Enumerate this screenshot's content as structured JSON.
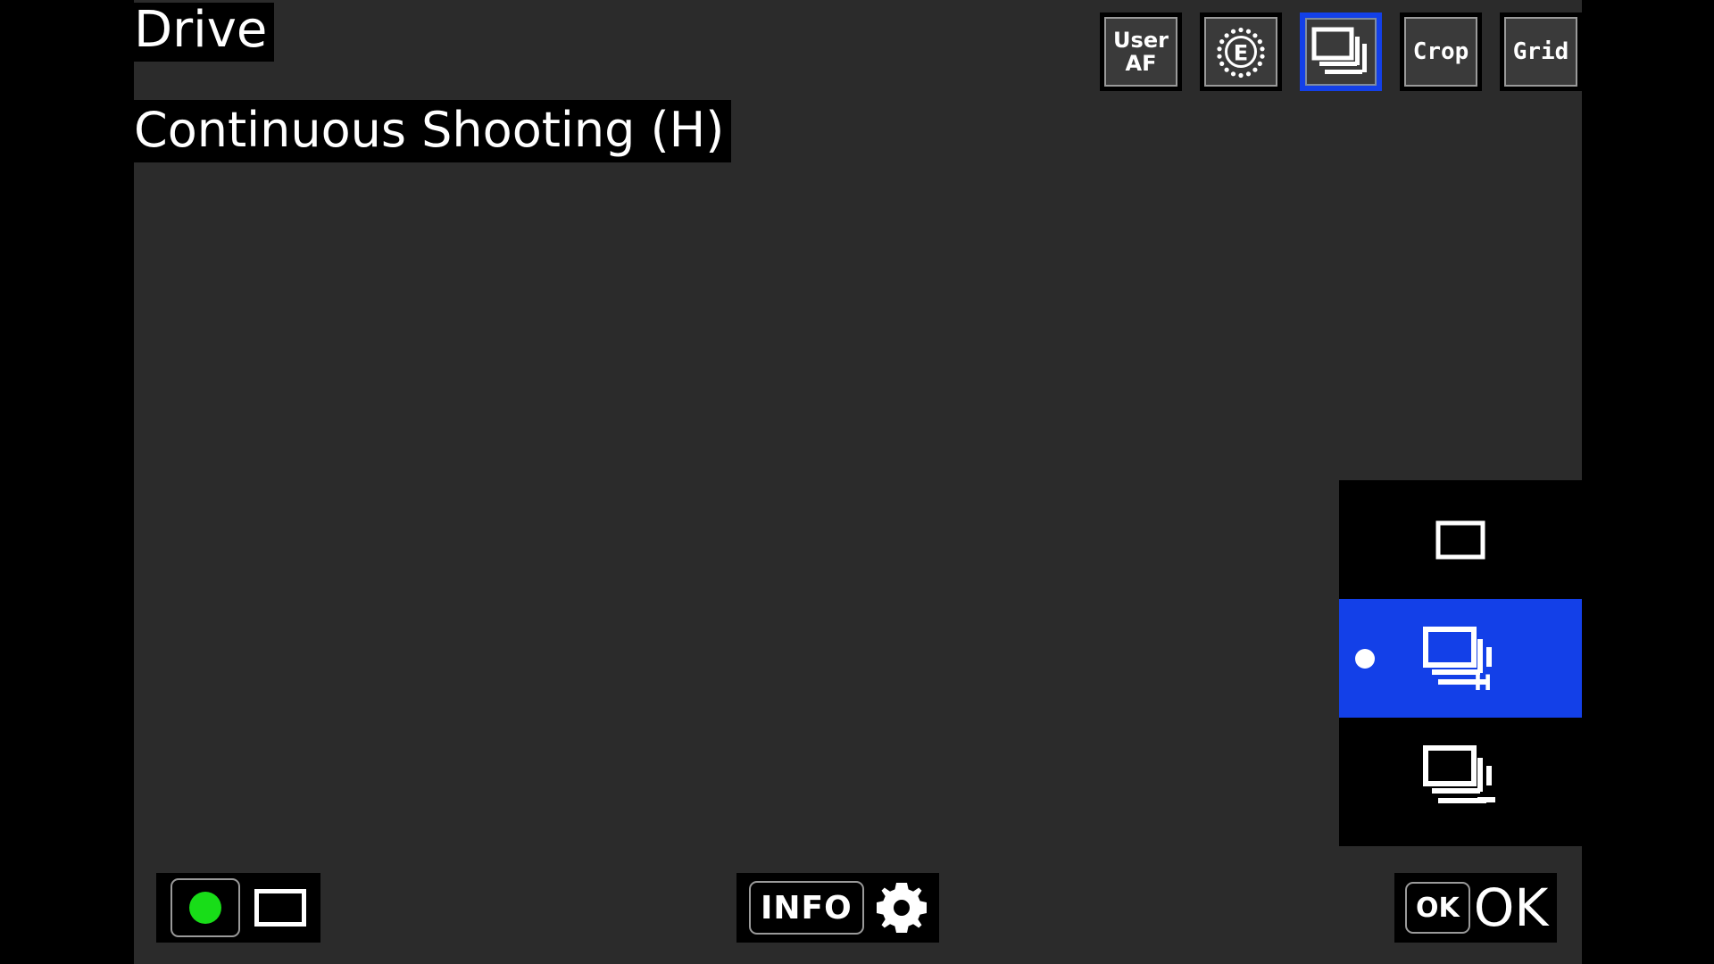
{
  "screen": {
    "name": "drive-mode-screen",
    "background_color": "#000000",
    "liveview_color": "#2b2b2b",
    "accent_color": "#1340e8",
    "record_dot_color": "#18dd18"
  },
  "header": {
    "title": "Drive",
    "value": "Continuous Shooting (H)"
  },
  "toolbar": {
    "items": [
      {
        "id": "user-af",
        "icon": "user-af-icon",
        "label_line1": "User",
        "label_line2": "AF",
        "type": "two-line-text",
        "selected": false
      },
      {
        "id": "metering",
        "icon": "metering-dial-icon",
        "label": "E",
        "type": "dial",
        "selected": false
      },
      {
        "id": "drive",
        "icon": "drive-burst-icon",
        "label": "",
        "type": "glyph",
        "selected": true
      },
      {
        "id": "crop",
        "icon": "crop-icon",
        "label": "Crop",
        "type": "word",
        "selected": false
      },
      {
        "id": "grid",
        "icon": "grid-icon",
        "label": "Grid",
        "type": "word",
        "selected": false
      }
    ]
  },
  "dropdown": {
    "name": "drive-mode-list",
    "items": [
      {
        "id": "single-frame",
        "icon": "single-frame-icon",
        "badge": "",
        "selected": false
      },
      {
        "id": "continuous-high",
        "icon": "continuous-high-icon",
        "badge": "H",
        "selected": true
      },
      {
        "id": "continuous-low",
        "icon": "continuous-low-icon",
        "badge": "L",
        "selected": false
      }
    ]
  },
  "bottom_bar": {
    "left": {
      "record_button_label": "",
      "record_icon": "record-dot-icon",
      "frame_icon": "frame-box-icon"
    },
    "center": {
      "info_label": "INFO",
      "gear_icon": "gear-icon"
    },
    "right": {
      "ok_button_label": "OK",
      "ok_text": "OK"
    }
  }
}
